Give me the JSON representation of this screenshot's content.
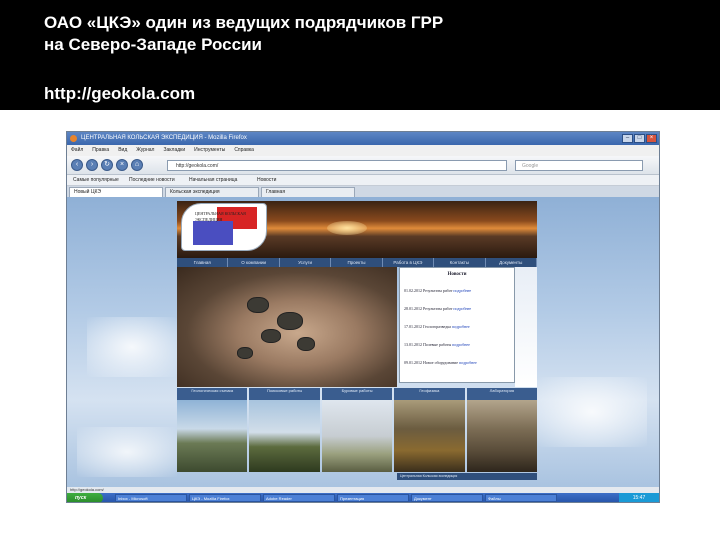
{
  "slide": {
    "title_line1": "ОАО «ЦКЭ» один из ведущих подрядчиков ГРР",
    "title_line2": "на Северо-Западе России",
    "url": "http://geokola.com"
  },
  "browser": {
    "window_title": "ЦЕНТРАЛЬНАЯ КОЛЬСКАЯ ЭКСПЕДИЦИЯ - Mozilla Firefox",
    "menu": [
      "Файл",
      "Правка",
      "Вид",
      "Журнал",
      "Закладки",
      "Инструменты",
      "Справка"
    ],
    "address": "http://geokola.com/",
    "search_placeholder": "Google",
    "bookmarks": [
      "Самые популярные",
      "Последние новости",
      "Начальная страница",
      "Новости"
    ],
    "tabs": [
      "Новый ЦКЭ",
      "Кольская экспедиция",
      "Главная"
    ],
    "status_text": "http://geokola.com/",
    "taskbar_start": "пуск",
    "taskbar_items": [
      "Inbox - Microsoft",
      "ЦКЭ - Mozilla Firefox",
      "Adobe Reader",
      "Презентация",
      "Документ",
      "Файлы"
    ],
    "clock": "15:47",
    "colors": {
      "titlebar": "#3a67ad",
      "nav_strip": "#2f4f7c",
      "taskbar": "#2553a8",
      "start": "#2a8a2a",
      "logo_red": "#d72424",
      "logo_blue": "#4a4ec0"
    }
  },
  "site": {
    "logo_text": "ЦЕНТРАЛЬНАЯ КОЛЬСКАЯ ЭКСПЕДИЦИЯ",
    "nav": [
      "Главная",
      "О компании",
      "Услуги",
      "Проекты",
      "Работа в ЦКЭ",
      "Контакты",
      "Документы"
    ],
    "news_title": "Новости",
    "news": [
      {
        "date": "01.02.2012",
        "text": "Результаты работ",
        "link": "подробнее"
      },
      {
        "date": "28.01.2012",
        "text": "Результаты работ",
        "link": "подробнее"
      },
      {
        "date": "17.01.2012",
        "text": "Геологоразведка",
        "link": "подробнее"
      },
      {
        "date": "13.01.2012",
        "text": "Полевые работы",
        "link": "подробнее"
      },
      {
        "date": "09.01.2012",
        "text": "Новое оборудование",
        "link": "подробнее"
      }
    ],
    "thumb_captions": [
      "Геологическая съемка",
      "Поисковые работы",
      "Буровые работы",
      "Геофизика",
      "Лаборатория"
    ],
    "footer": "Центральная Кольская экспедиция"
  }
}
